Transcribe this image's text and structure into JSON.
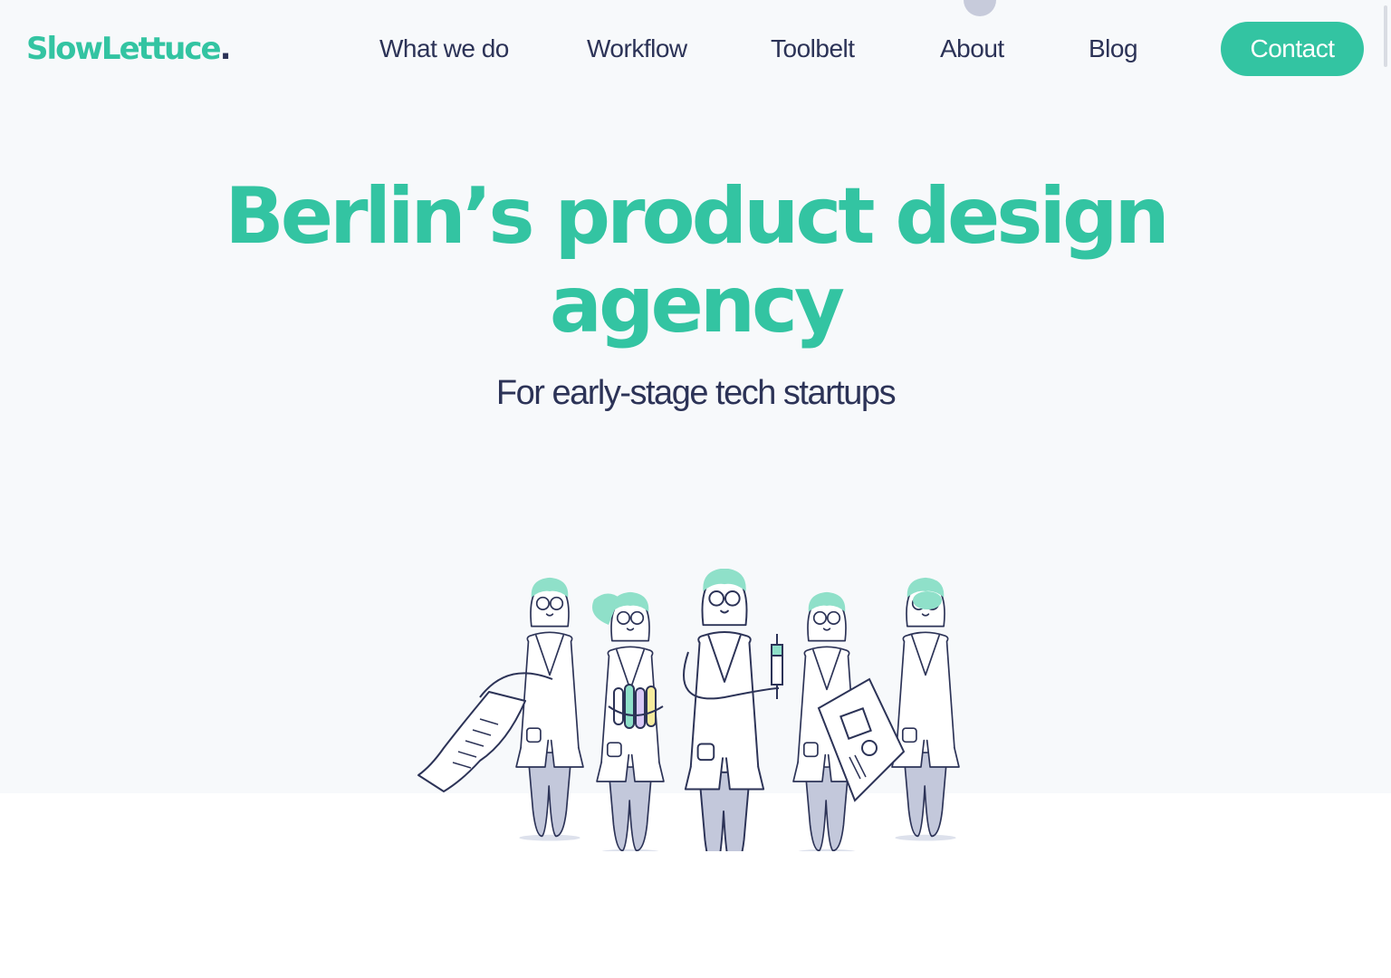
{
  "logo": {
    "text": "SlowLettuce",
    "dot": "."
  },
  "nav": {
    "items": [
      {
        "label": "What we do"
      },
      {
        "label": "Workflow"
      },
      {
        "label": "Toolbelt"
      },
      {
        "label": "About"
      },
      {
        "label": "Blog"
      }
    ],
    "contact_label": "Contact"
  },
  "hero": {
    "headline": "Berlin’s product design agency",
    "subheadline": "For early-stage tech startups"
  },
  "illustration": {
    "subject": "team-of-scientists",
    "figures": 5
  },
  "colors": {
    "brand_green": "#33c4a2",
    "navy": "#2c3357",
    "hero_background": "#f7f9fb",
    "leg_gray": "#c3c8db"
  }
}
